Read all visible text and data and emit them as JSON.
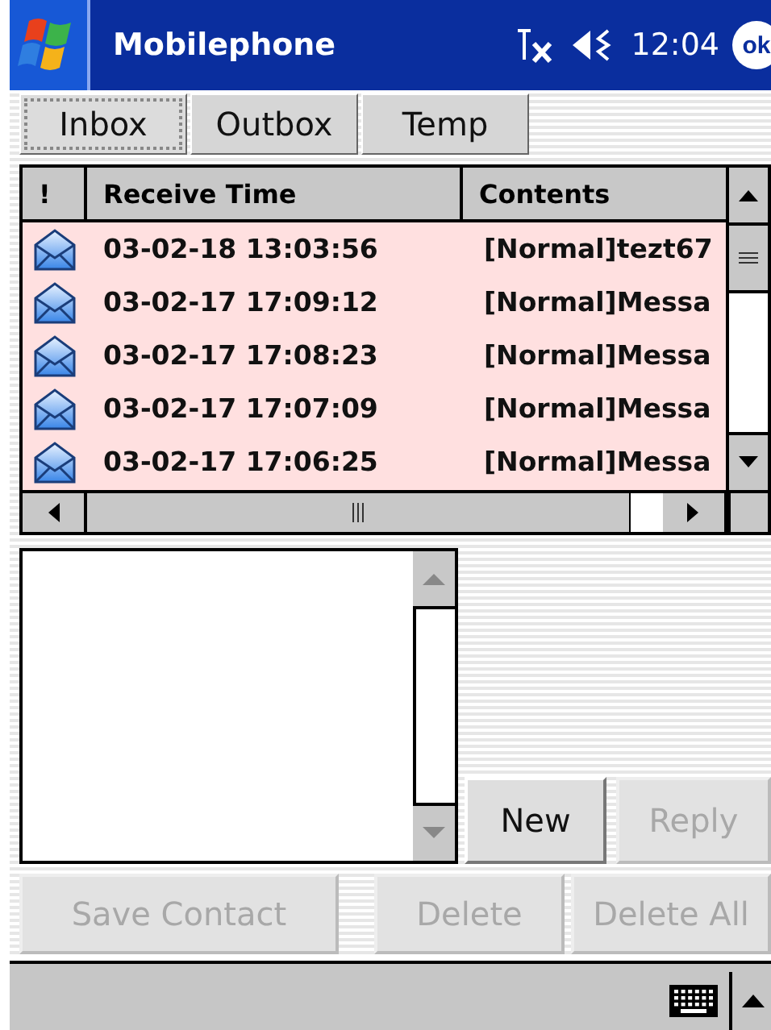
{
  "title_bar": {
    "title": "Mobilephone",
    "time": "12:04",
    "ok_label": "ok"
  },
  "tabs": [
    {
      "label": "Inbox",
      "selected": true
    },
    {
      "label": "Outbox",
      "selected": false
    },
    {
      "label": "Temp",
      "selected": false
    }
  ],
  "message_list": {
    "columns": [
      "!",
      "Receive Time",
      "Contents"
    ],
    "rows": [
      {
        "time": "03-02-18 13:03:56",
        "contents": "[Normal]tezt67"
      },
      {
        "time": "03-02-17 17:09:12",
        "contents": "[Normal]Messa"
      },
      {
        "time": "03-02-17 17:08:23",
        "contents": "[Normal]Messa"
      },
      {
        "time": "03-02-17 17:07:09",
        "contents": "[Normal]Messa"
      },
      {
        "time": "03-02-17 17:06:25",
        "contents": "[Normal]Messa"
      }
    ]
  },
  "side_buttons": [
    {
      "label": "New",
      "disabled": false
    },
    {
      "label": "Reply",
      "disabled": true
    }
  ],
  "bottom_buttons": [
    {
      "label": "Save Contact",
      "disabled": true
    },
    {
      "label": "Delete",
      "disabled": true
    },
    {
      "label": "Delete All",
      "disabled": true
    }
  ]
}
